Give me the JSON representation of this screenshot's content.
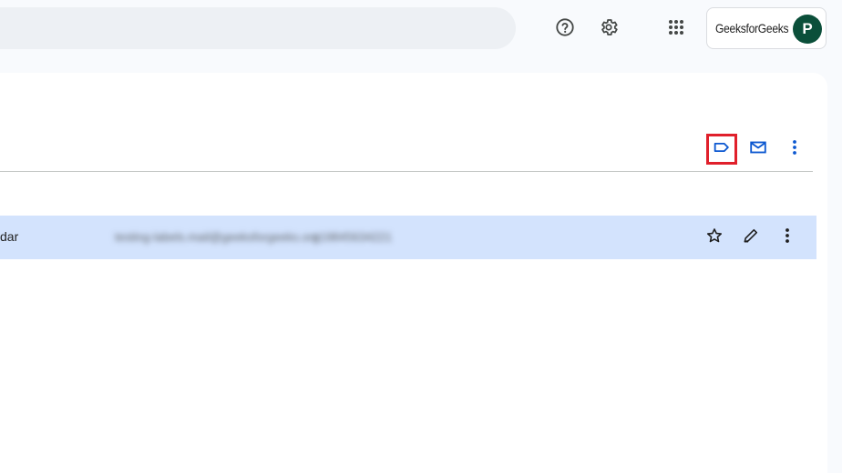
{
  "header": {
    "search_placeholder": "",
    "help_icon": "help-circle-icon",
    "settings_icon": "gear-icon",
    "apps_icon": "apps-grid-icon",
    "brand": "GeeksforGeeks",
    "avatar_initial": "P",
    "avatar_color": "#0b4f3a"
  },
  "toolbar": {
    "label_icon": "label-icon",
    "mail_icon": "mail-icon",
    "more_icon": "more-vert-icon",
    "highlight_color": "#e0202b",
    "accent_color": "#0b57d0"
  },
  "row": {
    "name_fragment": "dar",
    "email_blurred": "testing-labels.mail@geeksforgeeks.org",
    "phone_blurred": "+19845634221",
    "star_icon": "star-outline-icon",
    "edit_icon": "pencil-icon",
    "more_icon": "more-vert-icon",
    "highlight_bg": "#d3e3fd"
  }
}
